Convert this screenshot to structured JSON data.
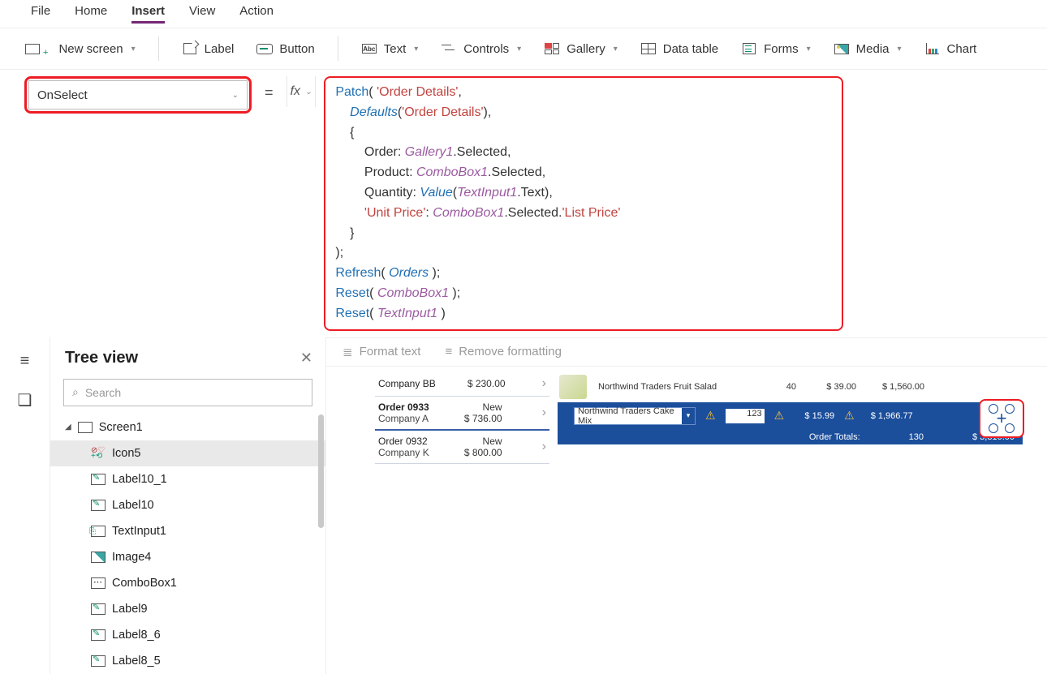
{
  "menubar": {
    "items": [
      "File",
      "Home",
      "Insert",
      "View",
      "Action"
    ],
    "active_index": 2
  },
  "ribbon": {
    "new_screen": "New screen",
    "label": "Label",
    "button": "Button",
    "text": "Text",
    "controls": "Controls",
    "gallery": "Gallery",
    "data_table": "Data table",
    "forms": "Forms",
    "media": "Media",
    "chart": "Chart"
  },
  "property_select": {
    "value": "OnSelect"
  },
  "formula": {
    "lines": [
      [
        [
          "fn",
          "Patch"
        ],
        [
          "punc",
          "( "
        ],
        [
          "str",
          "'Order Details'"
        ],
        [
          "punc",
          ","
        ]
      ],
      [
        [
          "sp",
          "    "
        ],
        [
          "id",
          "Defaults"
        ],
        [
          "punc",
          "("
        ],
        [
          "str",
          "'Order Details'"
        ],
        [
          "punc",
          "),"
        ]
      ],
      [
        [
          "sp",
          "    "
        ],
        [
          "punc",
          "{"
        ]
      ],
      [
        [
          "sp",
          "        "
        ],
        [
          "punc",
          "Order: "
        ],
        [
          "arg",
          "Gallery1"
        ],
        [
          "punc",
          ".Selected,"
        ]
      ],
      [
        [
          "sp",
          "        "
        ],
        [
          "punc",
          "Product: "
        ],
        [
          "arg",
          "ComboBox1"
        ],
        [
          "punc",
          ".Selected,"
        ]
      ],
      [
        [
          "sp",
          "        "
        ],
        [
          "punc",
          "Quantity: "
        ],
        [
          "id",
          "Value"
        ],
        [
          "punc",
          "("
        ],
        [
          "arg",
          "TextInput1"
        ],
        [
          "punc",
          ".Text),"
        ]
      ],
      [
        [
          "sp",
          "        "
        ],
        [
          "str",
          "'Unit Price'"
        ],
        [
          "punc",
          ": "
        ],
        [
          "arg",
          "ComboBox1"
        ],
        [
          "punc",
          ".Selected."
        ],
        [
          "str",
          "'List Price'"
        ]
      ],
      [
        [
          "sp",
          "    "
        ],
        [
          "punc",
          "}"
        ]
      ],
      [
        [
          "punc",
          ");"
        ]
      ],
      [
        [
          "fn",
          "Refresh"
        ],
        [
          "punc",
          "( "
        ],
        [
          "id",
          "Orders"
        ],
        [
          "punc",
          " );"
        ]
      ],
      [
        [
          "fn",
          "Reset"
        ],
        [
          "punc",
          "( "
        ],
        [
          "arg",
          "ComboBox1"
        ],
        [
          "punc",
          " );"
        ]
      ],
      [
        [
          "fn",
          "Reset"
        ],
        [
          "punc",
          "( "
        ],
        [
          "arg",
          "TextInput1"
        ],
        [
          "punc",
          " )"
        ]
      ]
    ]
  },
  "format_bar": {
    "format": "Format text",
    "remove": "Remove formatting"
  },
  "treeview": {
    "title": "Tree view",
    "search_placeholder": "Search",
    "items": [
      {
        "name": "Screen1",
        "icon": "screen",
        "level": 1,
        "expanded": true
      },
      {
        "name": "Icon5",
        "icon": "icon5",
        "level": 2,
        "selected": true
      },
      {
        "name": "Label10_1",
        "icon": "label",
        "level": 2
      },
      {
        "name": "Label10",
        "icon": "label",
        "level": 2
      },
      {
        "name": "TextInput1",
        "icon": "txt",
        "level": 2
      },
      {
        "name": "Image4",
        "icon": "img",
        "level": 2
      },
      {
        "name": "ComboBox1",
        "icon": "combo",
        "level": 2
      },
      {
        "name": "Label9",
        "icon": "label",
        "level": 2
      },
      {
        "name": "Label8_6",
        "icon": "label",
        "level": 2
      },
      {
        "name": "Label8_5",
        "icon": "label",
        "level": 2
      }
    ]
  },
  "preview": {
    "orders": [
      {
        "l1": "Company BB",
        "l2": "",
        "r1": "",
        "r2": "$ 230.00"
      },
      {
        "l1": "Order 0933",
        "l2": "Company A",
        "r1": "New",
        "r2": "$ 736.00",
        "active": true
      },
      {
        "l1": "Order 0932",
        "l2": "Company K",
        "r1": "New",
        "r2": "$ 800.00"
      }
    ],
    "detail_line": {
      "name": "Northwind Traders Fruit Salad",
      "qty": "40",
      "price": "$ 39.00",
      "ext": "$ 1,560.00"
    },
    "blue_line": {
      "combo": "Northwind Traders Cake Mix",
      "qty": "123",
      "price": "$ 15.99",
      "ext": "$ 1,966.77"
    },
    "totals": {
      "label": "Order Totals:",
      "qty": "130",
      "ext": "$ 3,810.00"
    }
  }
}
